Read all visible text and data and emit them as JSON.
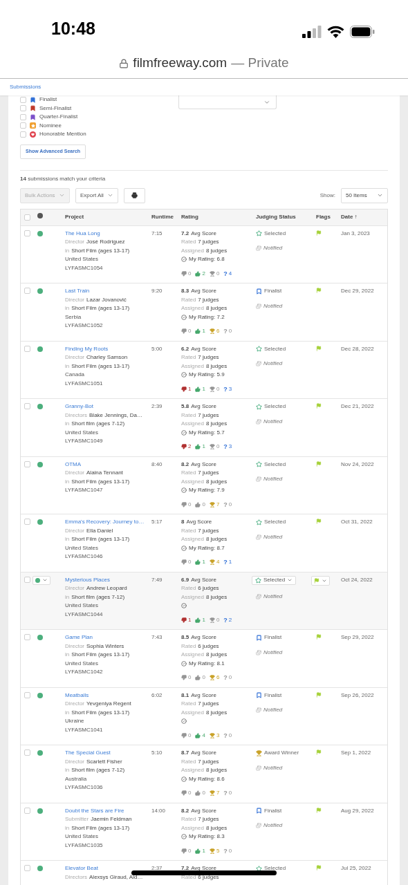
{
  "status_bar": {
    "time": "10:48"
  },
  "browser": {
    "url": "filmfreeway.com",
    "privacy": "— Private"
  },
  "nav": {
    "title": "Submissions"
  },
  "filters": [
    {
      "label": "Finalist",
      "kind": "bookmark",
      "color": "#2f6fd6",
      "checked": false
    },
    {
      "label": "Semi-Finalist",
      "kind": "bookmark",
      "color": "#c0392b",
      "checked": false
    },
    {
      "label": "Quarter-Finalist",
      "kind": "bookmark",
      "color": "#7b4fc9",
      "checked": false
    },
    {
      "label": "Nominee",
      "kind": "star",
      "color": "#f0a030",
      "checked": false
    },
    {
      "label": "Honorable Mention",
      "kind": "heart",
      "color": "#e0444f",
      "checked": false
    }
  ],
  "advanced_search_button": "Show Advanced Search",
  "results_text": "**14** submissions match your criteria",
  "toolbar": {
    "bulk_actions": {
      "label": "Bulk Actions",
      "disabled": true
    },
    "export": "Export All",
    "show_label": "Show:",
    "show_value": "50 Items"
  },
  "table": {
    "select_all_checked": false,
    "columns": [
      "Project",
      "Runtime",
      "Rating",
      "Judging Status",
      "Flags",
      "Date ↑"
    ],
    "rows": [
      {
        "title": "The Hua Long",
        "role": "Director",
        "person": "José Rodriguez",
        "in": "in",
        "category": "Short Film (ages 13-17)",
        "country": "United States",
        "code": "LYFASMC1054",
        "runtime": "7:15",
        "avg": "7.2",
        "avg_label": "Avg Score",
        "rated_label": "Rated",
        "rated": "7 judges",
        "assigned_label": "Assigned",
        "assigned": "8 judges",
        "rating_done": true,
        "my_rating": "My Rating: 6.8",
        "votes": [
          {
            "kind": "down",
            "value": "0",
            "active": false
          },
          {
            "kind": "up",
            "value": "2",
            "active": true
          },
          {
            "kind": "trophy",
            "value": "0",
            "active": false
          },
          {
            "kind": "question",
            "glyph": "?",
            "value": "4",
            "active": true
          }
        ],
        "status": {
          "kind": "selected",
          "label": "Selected"
        },
        "notified": "Notified",
        "flagged": true,
        "date": "Jan 3, 2023",
        "hovered": false,
        "checked": false
      },
      {
        "title": "Last Train",
        "role": "Director",
        "person": "Lazar Jovanović",
        "in": "in",
        "category": "Short Film (ages 13-17)",
        "country": "Serbia",
        "code": "LYFASMC1052",
        "runtime": "9:20",
        "avg": "8.3",
        "avg_label": "Avg Score",
        "rated_label": "Rated",
        "rated": "7 judges",
        "assigned_label": "Assigned",
        "assigned": "8 judges",
        "rating_done": true,
        "my_rating": "My Rating: 7.2",
        "votes": [
          {
            "kind": "down",
            "value": "0",
            "active": false
          },
          {
            "kind": "up",
            "value": "1",
            "active": true
          },
          {
            "kind": "trophy",
            "value": "6",
            "active": true
          },
          {
            "kind": "question",
            "glyph": "?",
            "value": "0",
            "active": false
          }
        ],
        "status": {
          "kind": "finalist",
          "label": "Finalist"
        },
        "notified": "Notified",
        "flagged": true,
        "date": "Dec 29, 2022",
        "hovered": false,
        "checked": false
      },
      {
        "title": "Finding My Roots",
        "role": "Director",
        "person": "Charley Samson",
        "in": "in",
        "category": "Short Film (ages 13-17)",
        "country": "Canada",
        "code": "LYFASMC1051",
        "runtime": "5:00",
        "avg": "6.2",
        "avg_label": "Avg Score",
        "rated_label": "Rated",
        "rated": "7 judges",
        "assigned_label": "Assigned",
        "assigned": "8 judges",
        "rating_done": true,
        "my_rating": "My Rating: 5.9",
        "votes": [
          {
            "kind": "down",
            "value": "1",
            "active": true
          },
          {
            "kind": "up",
            "value": "1",
            "active": true
          },
          {
            "kind": "trophy",
            "value": "0",
            "active": false
          },
          {
            "kind": "question",
            "glyph": "?",
            "value": "3",
            "active": true
          }
        ],
        "status": {
          "kind": "selected",
          "label": "Selected"
        },
        "notified": "Notified",
        "flagged": true,
        "date": "Dec 28, 2022",
        "hovered": false,
        "checked": false
      },
      {
        "title": "Granny-Bot",
        "role": "Directors",
        "person": "Blake Jennings, Da…",
        "in": "in",
        "category": "Short film (ages 7-12)",
        "country": "United States",
        "code": "LYFASMC1049",
        "runtime": "2:39",
        "avg": "5.8",
        "avg_label": "Avg Score",
        "rated_label": "Rated",
        "rated": "7 judges",
        "assigned_label": "Assigned",
        "assigned": "8 judges",
        "rating_done": true,
        "my_rating": "My Rating: 5.7",
        "votes": [
          {
            "kind": "down",
            "value": "2",
            "active": true
          },
          {
            "kind": "up",
            "value": "1",
            "active": true
          },
          {
            "kind": "trophy",
            "value": "0",
            "active": false
          },
          {
            "kind": "question",
            "glyph": "?",
            "value": "3",
            "active": true
          }
        ],
        "status": {
          "kind": "selected",
          "label": "Selected"
        },
        "notified": "Notified",
        "flagged": true,
        "date": "Dec 21, 2022",
        "hovered": false,
        "checked": false
      },
      {
        "title": "OTMA",
        "role": "Director",
        "person": "Alaina Tennant",
        "in": "in",
        "category": "Short Film (ages 13-17)",
        "code": "LYFASMC1047",
        "runtime": "8:40",
        "avg": "8.2",
        "avg_label": "Avg Score",
        "rated_label": "Rated",
        "rated": "7 judges",
        "assigned_label": "Assigned",
        "assigned": "8 judges",
        "rating_done": true,
        "my_rating": "My Rating: 7.9",
        "votes": [
          {
            "kind": "down",
            "value": "0",
            "active": false
          },
          {
            "kind": "up",
            "value": "0",
            "active": false
          },
          {
            "kind": "trophy",
            "value": "7",
            "active": true
          },
          {
            "kind": "question",
            "glyph": "?",
            "value": "0",
            "active": false
          }
        ],
        "status": {
          "kind": "selected",
          "label": "Selected"
        },
        "notified": "Notified",
        "flagged": true,
        "date": "Nov 24, 2022",
        "hovered": false,
        "checked": false
      },
      {
        "title": "Emma's Recovery: Journey to…",
        "role": "Director",
        "person": "Ella Daniel",
        "in": "in",
        "category": "Short Film (ages 13-17)",
        "country": "United States",
        "code": "LYFASMC1046",
        "runtime": "5:17",
        "avg": "8",
        "avg_label": "Avg Score",
        "rated_label": "Rated",
        "rated": "7 judges",
        "assigned_label": "Assigned",
        "assigned": "8 judges",
        "rating_done": true,
        "my_rating": "My Rating: 8.7",
        "votes": [
          {
            "kind": "down",
            "value": "0",
            "active": false
          },
          {
            "kind": "up",
            "value": "1",
            "active": true
          },
          {
            "kind": "trophy",
            "value": "4",
            "active": true
          },
          {
            "kind": "question",
            "glyph": "?",
            "value": "1",
            "active": true
          }
        ],
        "status": {
          "kind": "selected",
          "label": "Selected"
        },
        "notified": "Notified",
        "flagged": true,
        "date": "Oct 31, 2022",
        "hovered": false,
        "checked": false
      },
      {
        "title": "Mysterious Places",
        "role": "Director",
        "person": "Andrew Leopard",
        "in": "in",
        "category": "Short film (ages 7-12)",
        "country": "United States",
        "code": "LYFASMC1044",
        "runtime": "7:49",
        "avg": "6.9",
        "avg_label": "Avg Score",
        "rated_label": "Rated",
        "rated": "6 judges",
        "assigned_label": "Assigned",
        "assigned": "8 judges",
        "rating_done": true,
        "votes": [
          {
            "kind": "down",
            "value": "1",
            "active": true
          },
          {
            "kind": "up",
            "value": "1",
            "active": true
          },
          {
            "kind": "trophy",
            "value": "0",
            "active": false
          },
          {
            "kind": "question",
            "glyph": "?",
            "value": "2",
            "active": true
          }
        ],
        "status": {
          "kind": "selected",
          "label": "Selected"
        },
        "notified": "Notified",
        "flagged": true,
        "date": "Oct 24, 2022",
        "hovered": true,
        "checked": false
      },
      {
        "title": "Game Plan",
        "role": "Director",
        "person": "Sophia Winters",
        "in": "in",
        "category": "Short Film (ages 13-17)",
        "country": "United States",
        "code": "LYFASMC1042",
        "runtime": "7:43",
        "avg": "8.5",
        "avg_label": "Avg Score",
        "rated_label": "Rated",
        "rated": "6 judges",
        "assigned_label": "Assigned",
        "assigned": "8 judges",
        "rating_done": true,
        "my_rating": "My Rating: 8.1",
        "votes": [
          {
            "kind": "down",
            "value": "0",
            "active": false
          },
          {
            "kind": "up",
            "value": "0",
            "active": false
          },
          {
            "kind": "trophy",
            "value": "6",
            "active": true
          },
          {
            "kind": "question",
            "glyph": "?",
            "value": "0",
            "active": false
          }
        ],
        "status": {
          "kind": "finalist",
          "label": "Finalist"
        },
        "notified": "Notified",
        "flagged": true,
        "date": "Sep 29, 2022",
        "hovered": false,
        "checked": false
      },
      {
        "title": "Meatballs",
        "role": "Director",
        "person": "Yevgeniya Regent",
        "in": "in",
        "category": "Short Film (ages 13-17)",
        "country": "Ukraine",
        "code": "LYFASMC1041",
        "runtime": "6:02",
        "avg": "8.1",
        "avg_label": "Avg Score",
        "rated_label": "Rated",
        "rated": "7 judges",
        "assigned_label": "Assigned",
        "assigned": "8 judges",
        "rating_done": true,
        "votes": [
          {
            "kind": "down",
            "value": "0",
            "active": false
          },
          {
            "kind": "up",
            "value": "4",
            "active": true
          },
          {
            "kind": "trophy",
            "value": "3",
            "active": true
          },
          {
            "kind": "question",
            "glyph": "?",
            "value": "0",
            "active": false
          }
        ],
        "status": {
          "kind": "finalist",
          "label": "Finalist"
        },
        "notified": "Notified",
        "flagged": true,
        "date": "Sep 26, 2022",
        "hovered": false,
        "checked": false
      },
      {
        "title": "The Special Guest",
        "role": "Director",
        "person": "Scarlett Fisher",
        "in": "in",
        "category": "Short film (ages 7-12)",
        "country": "Australia",
        "code": "LYFASMC1036",
        "runtime": "5:10",
        "avg": "8.7",
        "avg_label": "Avg Score",
        "rated_label": "Rated",
        "rated": "7 judges",
        "assigned_label": "Assigned",
        "assigned": "8 judges",
        "rating_done": true,
        "my_rating": "My Rating: 8.6",
        "votes": [
          {
            "kind": "down",
            "value": "0",
            "active": false
          },
          {
            "kind": "up",
            "value": "0",
            "active": false
          },
          {
            "kind": "trophy",
            "value": "7",
            "active": true
          },
          {
            "kind": "question",
            "glyph": "?",
            "value": "0",
            "active": false
          }
        ],
        "status": {
          "kind": "award",
          "label": "Award Winner"
        },
        "notified": "Notified",
        "flagged": true,
        "date": "Sep 1, 2022",
        "hovered": false,
        "checked": false
      },
      {
        "title": "Doubt the Stars are Fire",
        "role": "Submitter",
        "person": "Jaemin Feldman",
        "in": "in",
        "category": "Short Film (ages 13-17)",
        "country": "United States",
        "code": "LYFASMC1035",
        "runtime": "14:00",
        "avg": "8.2",
        "avg_label": "Avg Score",
        "rated_label": "Rated",
        "rated": "7 judges",
        "assigned_label": "Assigned",
        "assigned": "8 judges",
        "rating_done": true,
        "my_rating": "My Rating: 8.3",
        "votes": [
          {
            "kind": "down",
            "value": "0",
            "active": false
          },
          {
            "kind": "up",
            "value": "1",
            "active": true
          },
          {
            "kind": "trophy",
            "value": "5",
            "active": true
          },
          {
            "kind": "question",
            "glyph": "?",
            "value": "0",
            "active": false
          }
        ],
        "status": {
          "kind": "finalist",
          "label": "Finalist"
        },
        "notified": "Notified",
        "flagged": true,
        "date": "Aug 29, 2022",
        "hovered": false,
        "checked": false
      },
      {
        "title": "Elevator Beat",
        "role": "Directors",
        "person": "Alexsys Giraud, Aid…",
        "runtime": "2:37",
        "avg": "7.2",
        "avg_label": "Avg Score",
        "rated_label": "Rated",
        "rated": "6 judges",
        "rating_done": false,
        "status": {
          "kind": "selected",
          "label": "Selected"
        },
        "flagged": true,
        "date": "Jul 25, 2022",
        "hovered": false,
        "checked": false
      }
    ]
  }
}
